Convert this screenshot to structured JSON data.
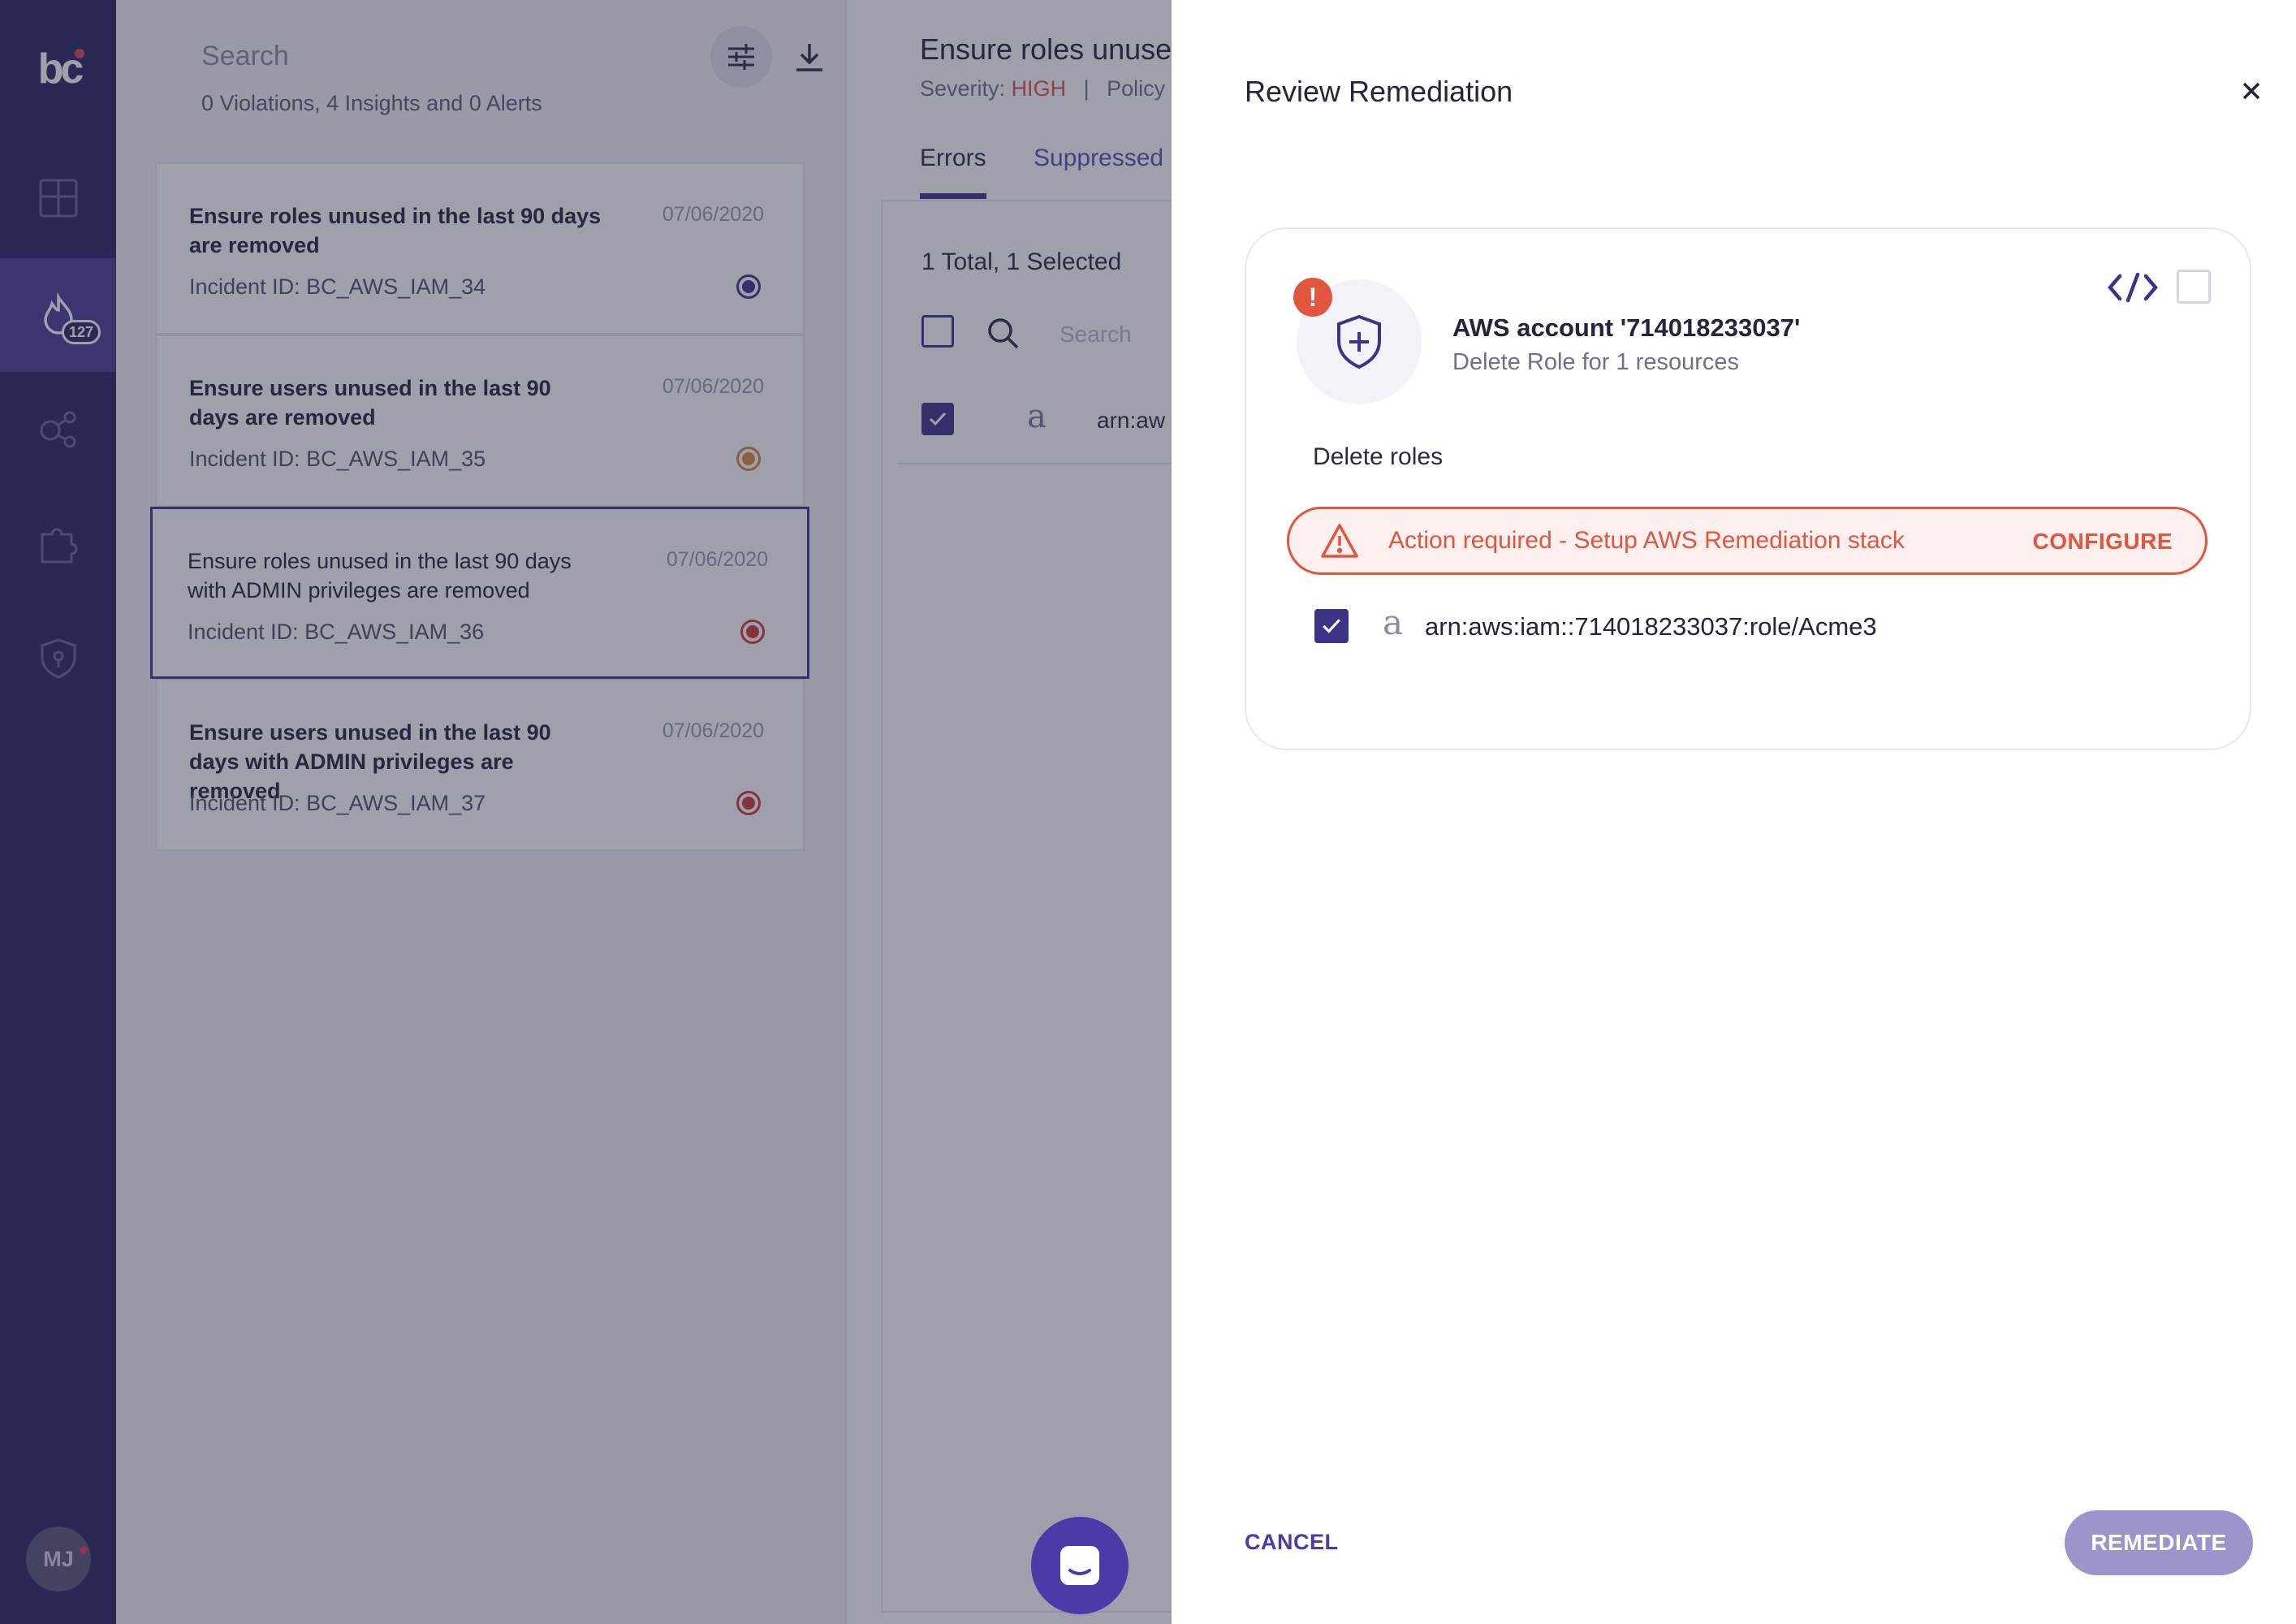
{
  "sidebar": {
    "logo_text": "bc",
    "badge_count": "127",
    "avatar_initials": "MJ",
    "icons": [
      "dashboard-icon",
      "incidents-icon",
      "connections-icon",
      "integrations-icon",
      "policy-shield-icon"
    ]
  },
  "list": {
    "search_placeholder": "Search",
    "summary": "0 Violations, 4 Insights and 0 Alerts",
    "cards": [
      {
        "title": "Ensure roles unused in the last 90 days are removed",
        "incident": "Incident ID: BC_AWS_IAM_34",
        "date": "07/06/2020",
        "color": "#3c3489"
      },
      {
        "title": "Ensure users unused in the last 90 days are removed",
        "incident": "Incident ID: BC_AWS_IAM_35",
        "date": "07/06/2020",
        "color": "#d98a3a"
      },
      {
        "title": "Ensure roles unused in the last 90 days with ADMIN privileges are removed",
        "incident": "Incident ID: BC_AWS_IAM_36",
        "date": "07/06/2020",
        "color": "#d63a3a"
      },
      {
        "title": "Ensure users unused in the last 90 days with ADMIN privileges are removed",
        "incident": "Incident ID: BC_AWS_IAM_37",
        "date": "07/06/2020",
        "color": "#d63a3a"
      }
    ]
  },
  "detail": {
    "title": "Ensure roles unuse",
    "severity_label": "Severity:",
    "severity_value": "HIGH",
    "separator": "|",
    "policy_label": "Policy",
    "tab_errors": "Errors",
    "tab_suppressed": "Suppressed",
    "total_selected": "1 Total, 1 Selected",
    "search_placeholder": "Search",
    "row_text": "arn:aw"
  },
  "drawer": {
    "title": "Review Remediation",
    "account_title": "AWS account '714018233037'",
    "account_subtitle": "Delete Role for 1 resources",
    "section_label": "Delete roles",
    "action_message": "Action required - Setup AWS Remediation stack",
    "configure_label": "CONFIGURE",
    "resource_arn": "arn:aws:iam::714018233037:role/Acme3",
    "cancel_label": "CANCEL",
    "remediate_label": "REMEDIATE",
    "alert_glyph": "!",
    "amazon_glyph": "a",
    "accent_color": "#3c3489",
    "warning_color": "#e2553f"
  }
}
